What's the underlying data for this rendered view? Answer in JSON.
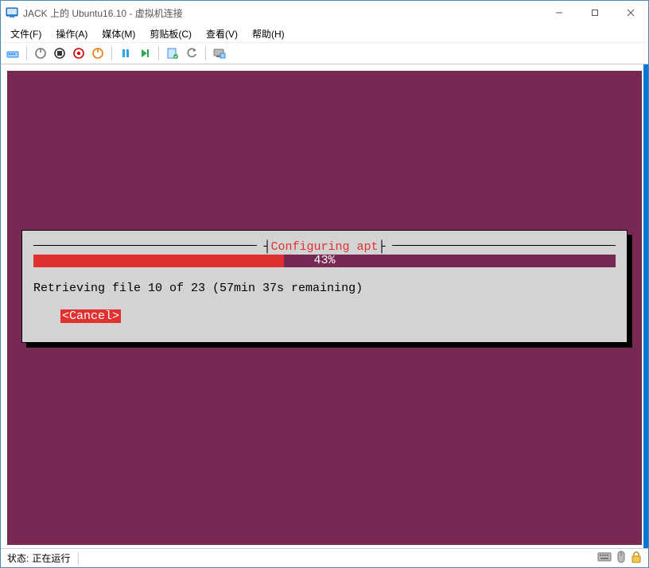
{
  "titlebar": {
    "title": "JACK 上的 Ubuntu16.10 - 虚拟机连接"
  },
  "menu": {
    "file": "文件(F)",
    "action": "操作(A)",
    "media": "媒体(M)",
    "clipboard": "剪贴板(C)",
    "view": "查看(V)",
    "help": "帮助(H)"
  },
  "installer": {
    "title": "Configuring apt",
    "progress_pct": 43,
    "progress_label": "43%",
    "status": "Retrieving file 10 of 23 (57min 37s remaining)",
    "cancel": "<Cancel>"
  },
  "statusbar": {
    "label": "状态:",
    "value": "正在运行"
  }
}
